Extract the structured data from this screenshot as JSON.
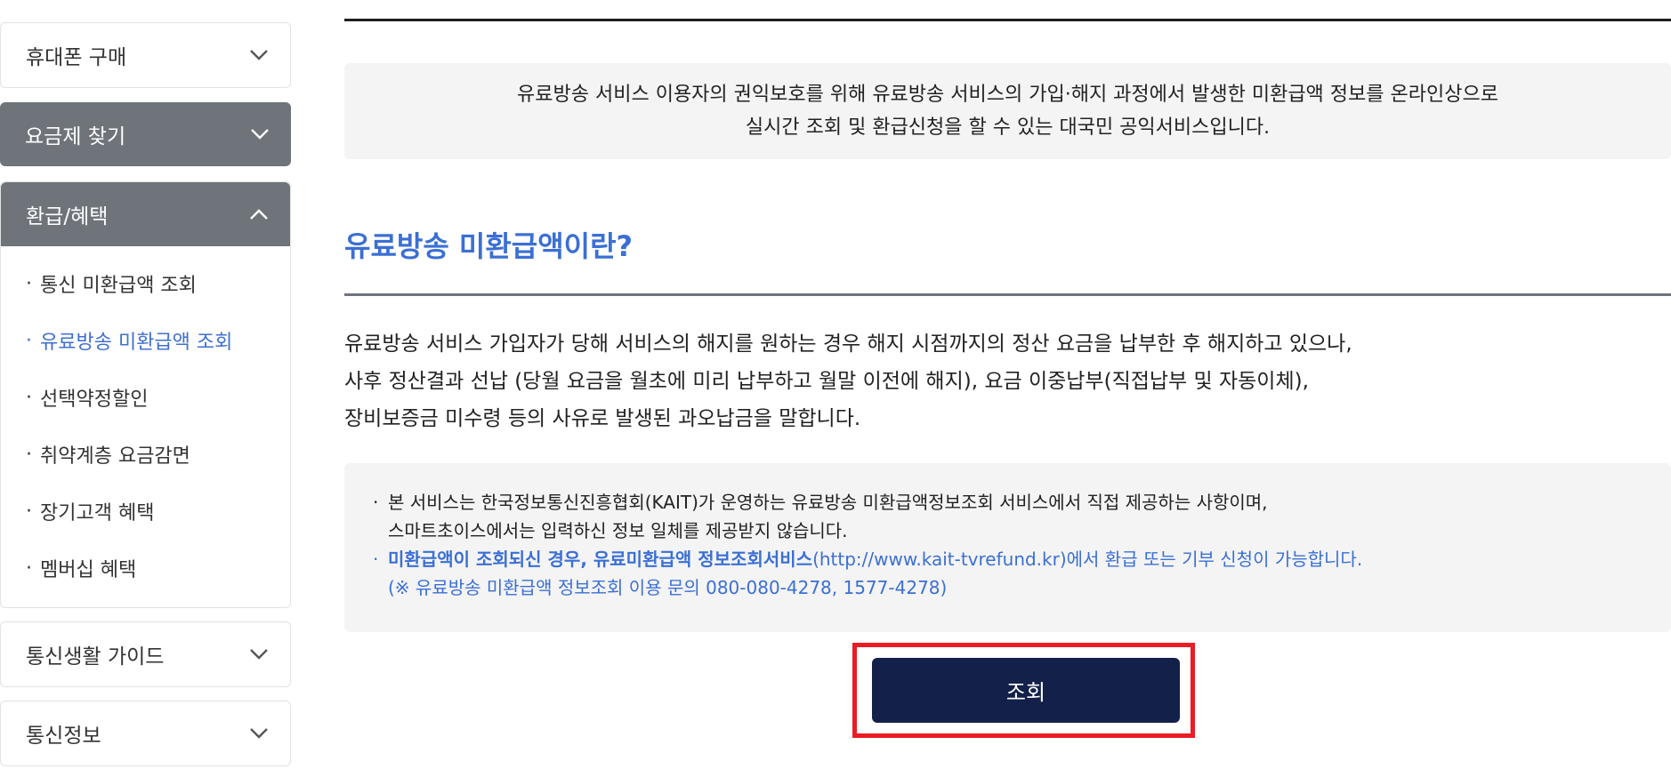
{
  "sidebar": {
    "menus": [
      {
        "label": "휴대폰 구매",
        "state": "collapsed"
      },
      {
        "label": "요금제 찾기",
        "state": "collapsed"
      },
      {
        "label": "환급/혜택",
        "state": "expanded"
      },
      {
        "label": "통신생활 가이드",
        "state": "collapsed"
      },
      {
        "label": "통신정보",
        "state": "collapsed"
      }
    ],
    "sub_items": [
      {
        "label": "통신 미환급액 조회",
        "active": false
      },
      {
        "label": "유료방송 미환급액 조회",
        "active": true
      },
      {
        "label": "선택약정할인",
        "active": false
      },
      {
        "label": "취약계층 요금감면",
        "active": false
      },
      {
        "label": "장기고객 혜택",
        "active": false
      },
      {
        "label": "멤버십 혜택",
        "active": false
      }
    ],
    "bullet": "·"
  },
  "main": {
    "intro": {
      "line1": "유료방송 서비스 이용자의 권익보호를 위해 유료방송 서비스의 가입·해지 과정에서 발생한 미환급액 정보를 온라인상으로",
      "line2": "실시간 조회 및 환급신청을 할 수 있는 대국민 공익서비스입니다."
    },
    "section_title": "유료방송 미환급액이란?",
    "description": {
      "line1": "유료방송 서비스 가입자가 당해 서비스의 해지를 원하는 경우 해지 시점까지의 정산 요금을 납부한 후 해지하고 있으나,",
      "line2": "사후 정산결과 선납 (당월 요금을 월초에 미리 납부하고 월말 이전에 해지), 요금 이중납부(직접납부 및 자동이체),",
      "line3": "장비보증금 미수령 등의 사유로 발생된 과오납금을 말합니다."
    },
    "notice": {
      "item1_line1": "본 서비스는 한국정보통신진흥협회(KAIT)가 운영하는 유료방송 미환급액정보조회 서비스에서 직접 제공하는 사항이며,",
      "item1_line2": "스마트초이스에서는 입력하신 정보 일체를 제공받지 않습니다.",
      "item2_bold": "미환급액이 조회되신 경우, 유료미환급액 정보조회서비스",
      "item2_rest": "(http://www.kait-tvrefund.kr)에서 환급 또는 기부 신청이 가능합니다.",
      "item2_line2": "(※ 유료방송 미환급액 정보조회 이용 문의 080-080-4278, 1577-4278)"
    },
    "search_button_label": "조회"
  },
  "colors": {
    "accent_blue": "#3b6fd4",
    "sidebar_dark": "#6f747b",
    "button_navy": "#13204a",
    "highlight_red": "#ea1c24"
  }
}
